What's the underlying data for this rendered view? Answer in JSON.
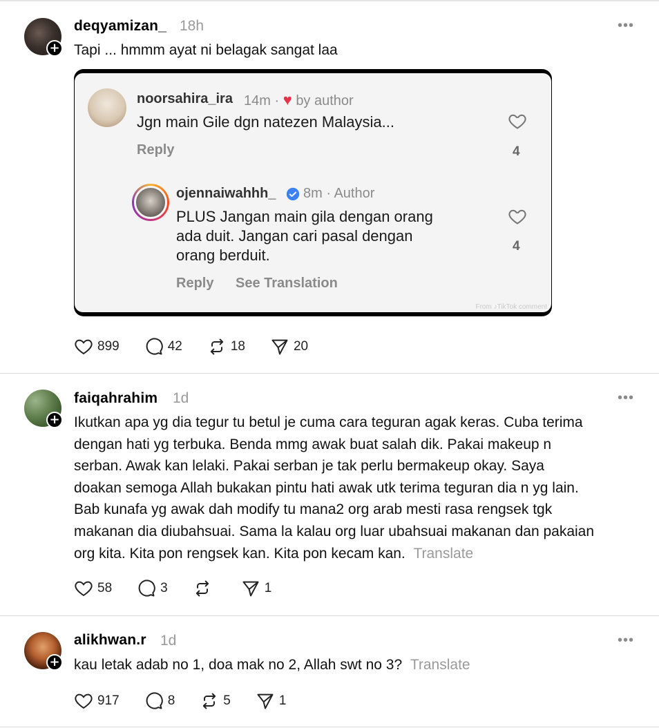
{
  "posts": [
    {
      "username": "deqyamizan_",
      "time": "18h",
      "more": "•••",
      "text": "Tapi ... hmmm ayat ni belagak sangat laa",
      "embed": {
        "comment1": {
          "username": "noorsahira_ira",
          "meta": "14m ·",
          "liked_label": "by author",
          "text": "Jgn main Gile dgn natezen Malaysia...",
          "reply": "Reply",
          "likes": "4"
        },
        "comment2": {
          "username": "ojennaiwahhh_",
          "meta": "8m · Author",
          "text_lines": [
            "PLUS Jangan main gila dengan orang",
            "ada duit. Jangan cari pasal dengan",
            "orang berduit."
          ],
          "reply": "Reply",
          "see_translation": "See Translation",
          "likes": "4"
        },
        "watermark": "From ♪TikTok comment"
      },
      "likes": "899",
      "comments": "42",
      "reposts": "18",
      "shares": "20"
    },
    {
      "username": "faiqahrahim",
      "time": "1d",
      "more": "•••",
      "text_lines": [
        "Ikutkan apa yg dia tegur tu betul je cuma cara teguran agak keras. Cuba terima",
        "dengan hati yg terbuka. Benda mmg awak buat salah dik. Pakai makeup n",
        "serban. Awak kan lelaki. Pakai serban je tak perlu bermakeup okay. Saya",
        "doakan semoga Allah bukakan pintu hati awak utk terima teguran dia n yg lain.",
        "Bab kunafa yg awak dah modify tu mana2 org arab mesti rasa rengsek tgk",
        "makanan dia diubahsuai. Sama la kalau org luar ubahsuai makanan dan pakaian",
        "org kita. Kita pon rengsek kan. Kita pon kecam kan."
      ],
      "translate": "Translate",
      "likes": "58",
      "comments": "3",
      "reposts": "",
      "shares": "1"
    },
    {
      "username": "alikhwan.r",
      "time": "1d",
      "more": "•••",
      "text": "kau letak adab no 1, doa mak no 2, Allah swt no 3?",
      "translate": "Translate",
      "likes": "917",
      "comments": "8",
      "reposts": "5",
      "shares": "1"
    }
  ],
  "colors": {
    "heart_red": "#e8314a",
    "verified_blue": "#3b82f6",
    "muted": "#9a9a9a"
  }
}
